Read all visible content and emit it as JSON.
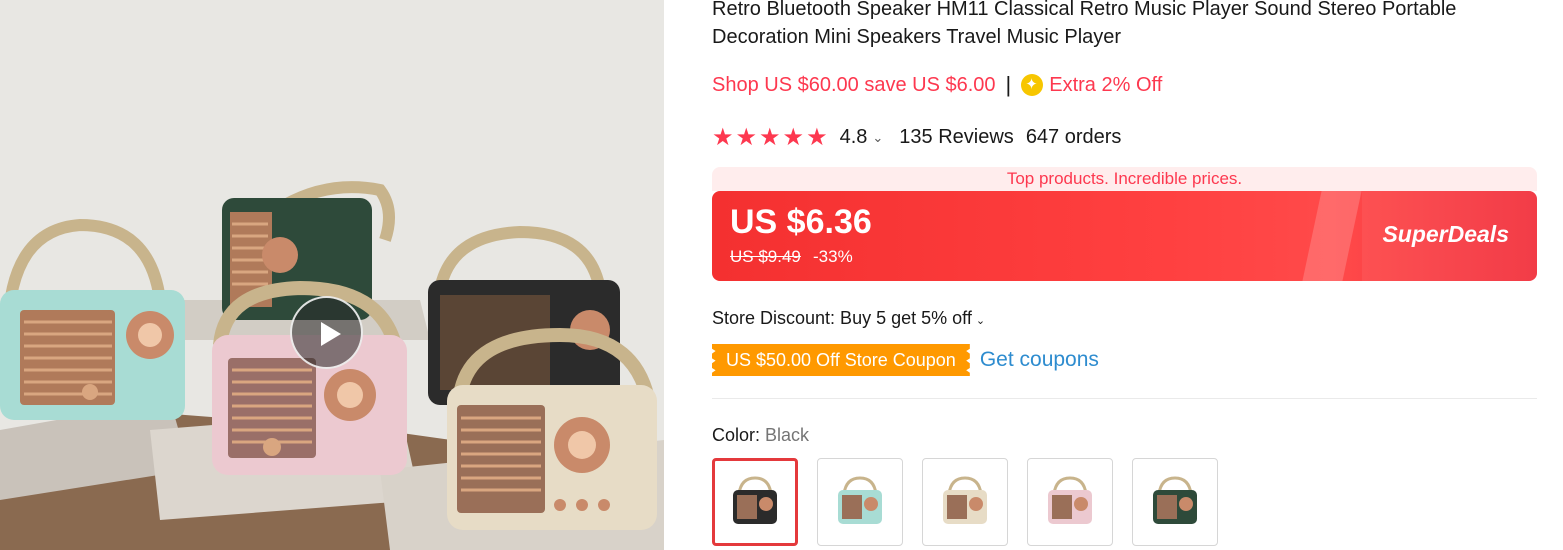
{
  "product": {
    "title": "Retro Bluetooth Speaker HM11 Classical Retro Music Player Sound Stereo Portable Decoration Mini Speakers Travel Music Player"
  },
  "promo": {
    "shop_text": "Shop US $60.00 save US $6.00",
    "separator": "|",
    "extra_text": "Extra 2% Off"
  },
  "rating": {
    "stars": "★★★★★",
    "score": "4.8",
    "reviews": "135 Reviews",
    "orders": "647 orders"
  },
  "superdeals": {
    "banner": "Top products. Incredible prices.",
    "price": "US $6.36",
    "original_price": "US $9.49",
    "discount": "-33%",
    "logo": "SuperDeals"
  },
  "store": {
    "discount_text": "Store Discount: Buy 5 get 5% off",
    "coupon_label": "US $50.00 Off Store Coupon",
    "get_coupons": "Get coupons"
  },
  "color": {
    "label": "Color:",
    "selected": "Black",
    "options": [
      {
        "name": "Black",
        "body": "#2b2b2b"
      },
      {
        "name": "Mint",
        "body": "#a8dcd4"
      },
      {
        "name": "Beige",
        "body": "#e7dcc6"
      },
      {
        "name": "Pink",
        "body": "#ecc9d0"
      },
      {
        "name": "Green",
        "body": "#2e4a3a"
      }
    ]
  },
  "colors": {
    "accent": "#fd384f",
    "coupon": "#ff9900",
    "link": "#2e8ccf"
  }
}
